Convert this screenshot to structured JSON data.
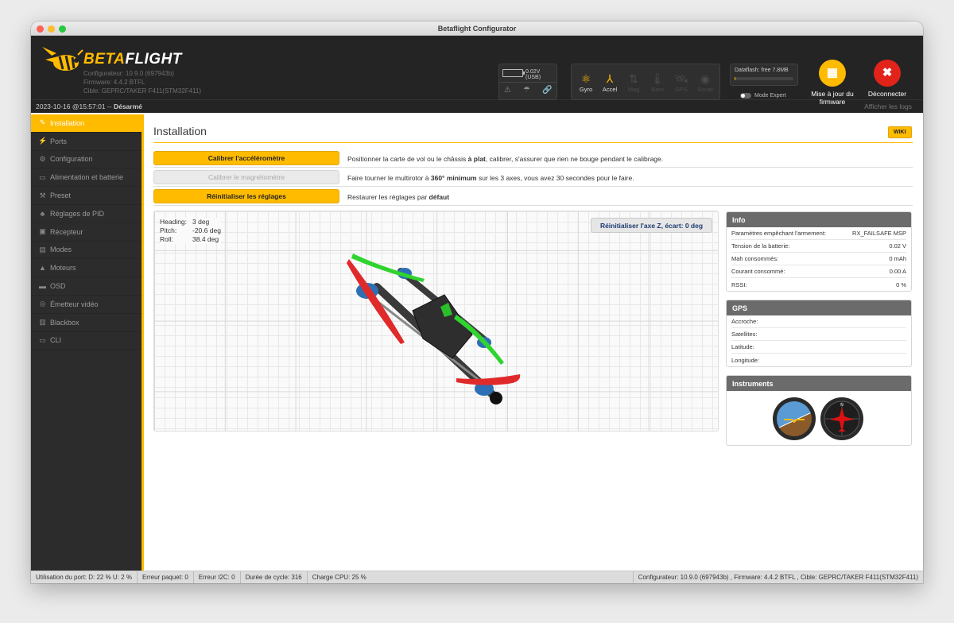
{
  "window": {
    "title": "Betaflight Configurator"
  },
  "header": {
    "brand_a": "BETA",
    "brand_b": "FLIGHT",
    "configurator": "Configurateur: 10.9.0 (697943b)",
    "firmware": "Firmware: 4.4.2 BTFL",
    "target": "Cible: GEPRC/TAKER F411(STM32F411)",
    "battery_voltage": "0.02V (USB)",
    "sensors": [
      {
        "label": "Gyro",
        "icon": "gyro-icon",
        "active": true
      },
      {
        "label": "Accel",
        "icon": "accel-icon",
        "active": true
      },
      {
        "label": "Mag",
        "icon": "mag-icon",
        "active": false
      },
      {
        "label": "Baro",
        "icon": "baro-icon",
        "active": false
      },
      {
        "label": "GPS",
        "icon": "gps-icon",
        "active": false
      },
      {
        "label": "Sonar",
        "icon": "sonar-icon",
        "active": false
      }
    ],
    "dataflash": "Dataflash: free 7.8MB",
    "dataflash_used_fraction": 0.02,
    "expert_mode": "Mode Expert",
    "firmware_update": "Mise à jour du firmware",
    "disconnect": "Déconnecter"
  },
  "status": {
    "datetime": "2023-10-16 @15:57:01 -- ",
    "armed": "Désarmé",
    "show_logs": "Afficher les logs"
  },
  "sidebar": {
    "items": [
      {
        "label": "Installation",
        "icon": "wrench-icon",
        "active": true
      },
      {
        "label": "Ports",
        "icon": "plug-icon"
      },
      {
        "label": "Configuration",
        "icon": "gear-icon"
      },
      {
        "label": "Alimentation et batterie",
        "icon": "battery-icon"
      },
      {
        "label": "Preset",
        "icon": "preset-icon"
      },
      {
        "label": "Réglages de PID",
        "icon": "pid-icon"
      },
      {
        "label": "Récepteur",
        "icon": "receiver-icon"
      },
      {
        "label": "Modes",
        "icon": "modes-icon"
      },
      {
        "label": "Moteurs",
        "icon": "motor-icon"
      },
      {
        "label": "OSD",
        "icon": "osd-icon"
      },
      {
        "label": "Émetteur vidéo",
        "icon": "vtx-icon"
      },
      {
        "label": "Blackbox",
        "icon": "blackbox-icon"
      },
      {
        "label": "CLI",
        "icon": "cli-icon"
      }
    ]
  },
  "main": {
    "title": "Installation",
    "wiki": "WIKI",
    "actions": [
      {
        "button": "Calibrer l'accéléromètre",
        "enabled": true,
        "pre": "Positionner la carte de vol ou le châssis ",
        "bold": "à plat",
        "post": ", calibrer, s'assurer que rien ne bouge pendant le calibrage."
      },
      {
        "button": "Calibrer le magnétomètre",
        "enabled": false,
        "pre": "Faire tourner le multirotor à ",
        "bold": "360° minimum",
        "post": " sur les 3 axes, vous avez 30 secondes pour le faire."
      },
      {
        "button": "Réinitialiser les réglages",
        "enabled": true,
        "pre": "Restaurer les réglages par ",
        "bold": "défaut",
        "post": ""
      }
    ],
    "attitude": {
      "heading_label": "Heading:",
      "heading": "3 deg",
      "pitch_label": "Pitch:",
      "pitch": "-20.6 deg",
      "roll_label": "Roll:",
      "roll": "38.4 deg"
    },
    "reset_z": "Réinitialiser l'axe Z, écart: 0 deg"
  },
  "info": {
    "title": "Info",
    "rows": [
      {
        "label": "Paramètres empêchant l'armement:",
        "value": "RX_FAILSAFE  MSP"
      },
      {
        "label": "Tension de la batterie:",
        "value": "0.02 V"
      },
      {
        "label": "Mah consommés:",
        "value": "0 mAh"
      },
      {
        "label": "Courant consommé:",
        "value": "0.00 A"
      },
      {
        "label": "RSSI:",
        "value": "0 %"
      }
    ]
  },
  "gps": {
    "title": "GPS",
    "rows": [
      {
        "label": "Accroche:",
        "value": ""
      },
      {
        "label": "Satellites:",
        "value": ""
      },
      {
        "label": "Latitude:",
        "value": ""
      },
      {
        "label": "Longitude:",
        "value": ""
      }
    ]
  },
  "instruments": {
    "title": "Instruments"
  },
  "footer": {
    "port_usage": "Utilisation du port: D: 22 % U: 2 %",
    "packet_error": "Erreur paquet: 0",
    "i2c_error": "Erreur I2C: 0",
    "cycle_time": "Durée de cycle: 316",
    "cpu_load": "Charge CPU: 25 %",
    "version": "Configurateur: 10.9.0 (697943b) , Firmware: 4.4.2 BTFL , Cible: GEPRC/TAKER F411(STM32F411)"
  }
}
